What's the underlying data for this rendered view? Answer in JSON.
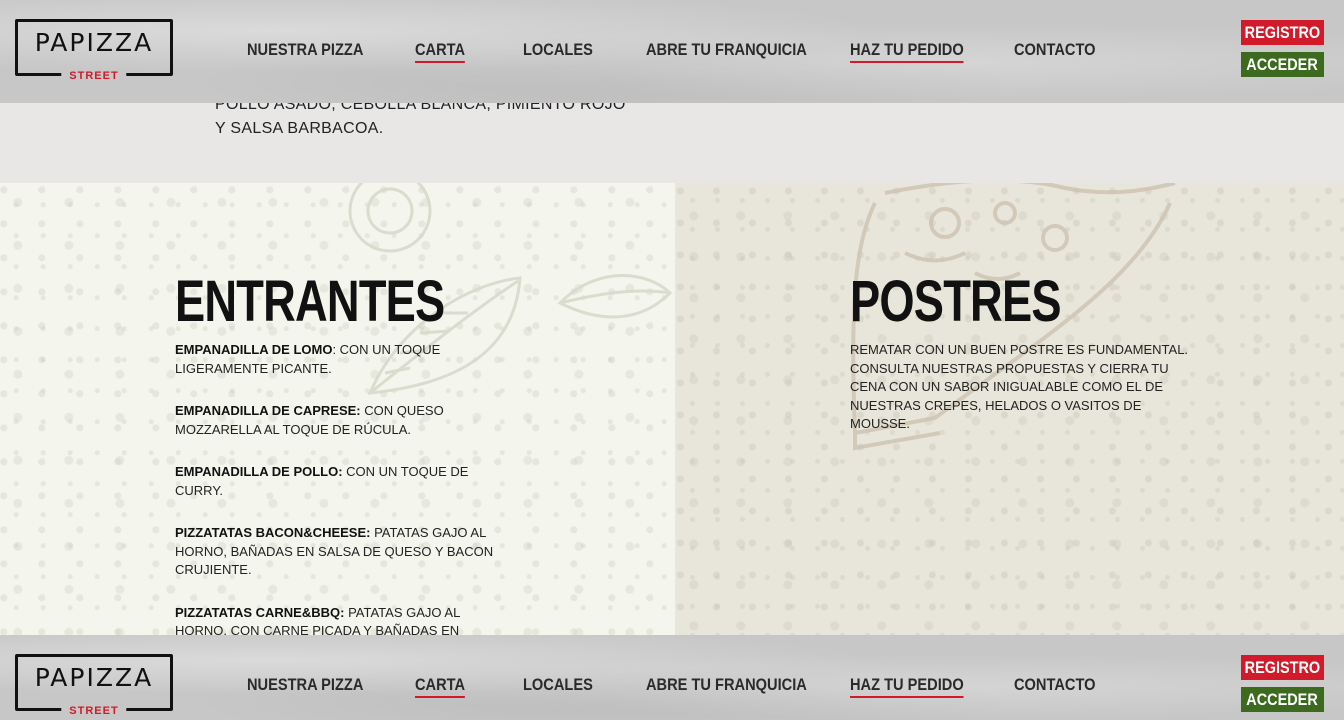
{
  "brand": {
    "name": "PAPIZZA",
    "tagline": "STREET"
  },
  "nav": [
    {
      "label": "NUESTRA PIZZA",
      "active": false
    },
    {
      "label": "CARTA",
      "active": true
    },
    {
      "label": "LOCALES",
      "active": false
    },
    {
      "label": "ABRE TU FRANQUICIA",
      "active": false
    },
    {
      "label": "HAZ TU PEDIDO",
      "active": true
    },
    {
      "label": "CONTACTO",
      "active": false
    }
  ],
  "auth": {
    "register_label": "REGISTRO",
    "login_label": "ACCEDER"
  },
  "colors": {
    "accent_red": "#d11a2a",
    "accent_green": "#3c6a1f"
  },
  "previous_section": {
    "text": "POLLO ASADO, CEBOLLA BLANCA, PIMIENTO ROJO Y SALSA BARBACOA."
  },
  "entrantes": {
    "title": "ENTRANTES",
    "items": [
      {
        "name": "EMPANADILLA DE LOMO",
        "desc": ": CON UN TOQUE LIGERAMENTE PICANTE."
      },
      {
        "name": "EMPANADILLA DE CAPRESE:",
        "desc": " CON QUESO MOZZARELLA AL TOQUE DE RÚCULA."
      },
      {
        "name": "EMPANADILLA DE POLLO:",
        "desc": " CON UN TOQUE DE CURRY."
      },
      {
        "name": "PIZZATATAS BACON&CHEESE:",
        "desc": " PATATAS GAJO AL HORNO, BAÑADAS EN SALSA DE QUESO Y BACON CRUJIENTE."
      },
      {
        "name": "PIZZATATAS CARNE&BBQ:",
        "desc": " PATATAS GAJO AL HORNO, CON CARNE PICADA Y BAÑADAS EN SALSA"
      }
    ]
  },
  "postres": {
    "title": "POSTRES",
    "description": "REMATAR CON UN BUEN POSTRE ES FUNDAMENTAL. CONSULTA NUESTRAS PROPUESTAS Y CIERRA TU CENA CON UN SABOR INIGUALABLE COMO EL DE NUESTRAS CREPES, HELADOS O VASITOS DE MOUSSE."
  }
}
